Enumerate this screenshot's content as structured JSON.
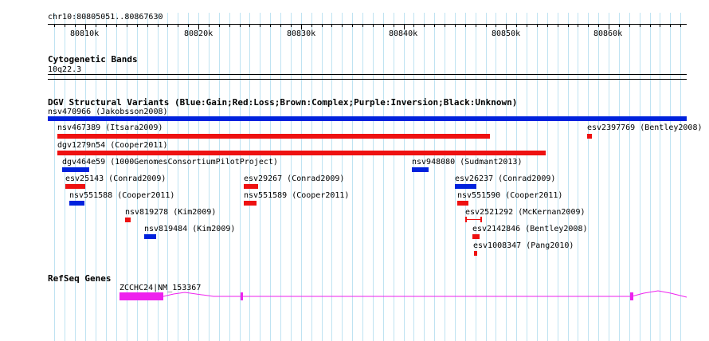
{
  "ruler": {
    "location": "chr10:80805051..80867630",
    "ticks": [
      "80810k",
      "80820k",
      "80830k",
      "80840k",
      "80850k",
      "80860k"
    ]
  },
  "cytobands": {
    "title": "Cytogenetic Bands",
    "band": "10q22.3"
  },
  "dgv": {
    "title": "DGV Structural Variants (Blue:Gain;Red:Loss;Brown:Complex;Purple:Inversion;Black:Unknown)",
    "colors": {
      "gain": "#0022dd",
      "loss": "#ee1111"
    },
    "features": [
      {
        "label": "nsv470966 (Jakobsson2008)",
        "type": "gain"
      },
      {
        "label": "nsv467389 (Itsara2009)",
        "type": "loss"
      },
      {
        "label": "esv2397769 (Bentley2008)",
        "type": "loss"
      },
      {
        "label": "dgv1279n54 (Cooper2011)",
        "type": "loss"
      },
      {
        "label": "dgv464e59 (1000GenomesConsortiumPilotProject)",
        "type": "gain"
      },
      {
        "label": "nsv948080 (Sudmant2013)",
        "type": "gain"
      },
      {
        "label": "esv25143 (Conrad2009)",
        "type": "loss"
      },
      {
        "label": "esv29267 (Conrad2009)",
        "type": "loss"
      },
      {
        "label": "esv26237 (Conrad2009)",
        "type": "gain"
      },
      {
        "label": "nsv551588 (Cooper2011)",
        "type": "gain"
      },
      {
        "label": "nsv551589 (Cooper2011)",
        "type": "loss"
      },
      {
        "label": "nsv551590 (Cooper2011)",
        "type": "loss"
      },
      {
        "label": "nsv819278 (Kim2009)",
        "type": "loss"
      },
      {
        "label": "esv2521292 (McKernan2009)",
        "type": "loss"
      },
      {
        "label": "nsv819484 (Kim2009)",
        "type": "gain"
      },
      {
        "label": "esv2142846 (Bentley2008)",
        "type": "loss"
      },
      {
        "label": "esv1008347 (Pang2010)",
        "type": "loss"
      }
    ]
  },
  "refseq": {
    "title": "RefSeq Genes",
    "gene_label": "ZCCHC24|NM_153367",
    "color": "#ee22ee"
  }
}
